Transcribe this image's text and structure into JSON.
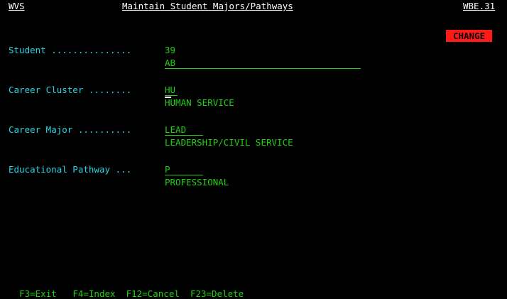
{
  "header": {
    "system": "WVS",
    "title": "Maintain Student Majors/Pathways",
    "program": "WBE.31"
  },
  "mode_badge": "CHANGE",
  "fields": {
    "student": {
      "label": "Student",
      "dots": " ...............",
      "value": "39",
      "name": "AB"
    },
    "career_cluster": {
      "label": "Career Cluster",
      "dots": " ........",
      "value": "HU",
      "description": "HUMAN SERVICE"
    },
    "career_major": {
      "label": "Career Major",
      "dots": " ..........",
      "value": "LEAD",
      "description": "LEADERSHIP/CIVIL SERVICE"
    },
    "educational_pathway": {
      "label": "Educational Pathway",
      "dots": " ...",
      "value": "P",
      "description": "PROFESSIONAL"
    }
  },
  "function_keys": [
    "F3=Exit",
    "F4=Index",
    "F12=Cancel",
    "F23=Delete"
  ]
}
